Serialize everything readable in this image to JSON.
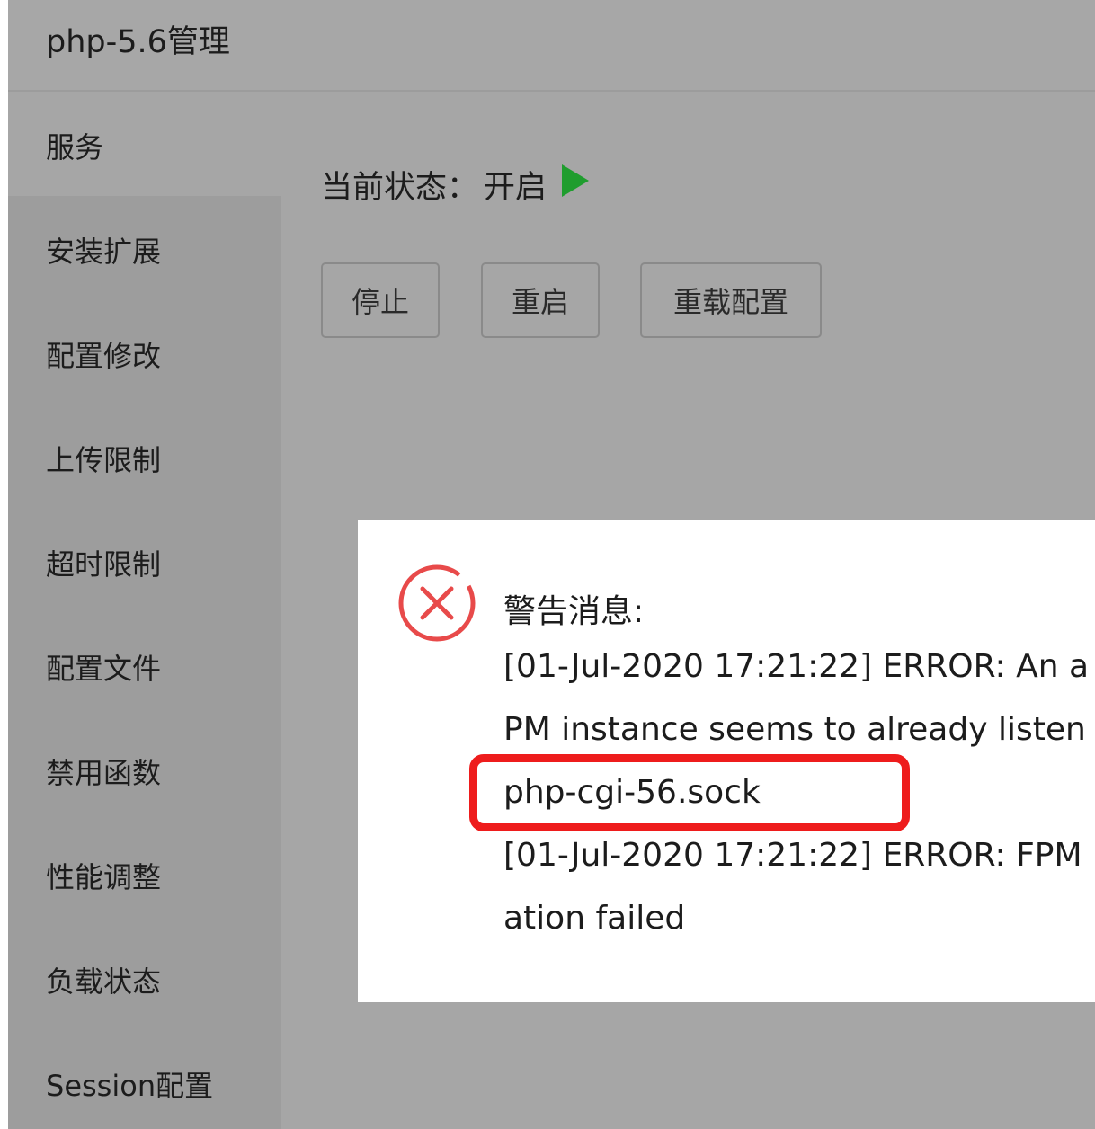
{
  "window": {
    "title": "php-5.6管理"
  },
  "sidebar": {
    "items": [
      {
        "label": "服务",
        "active": true
      },
      {
        "label": "安装扩展",
        "active": false
      },
      {
        "label": "配置修改",
        "active": false
      },
      {
        "label": "上传限制",
        "active": false
      },
      {
        "label": "超时限制",
        "active": false
      },
      {
        "label": "配置文件",
        "active": false
      },
      {
        "label": "禁用函数",
        "active": false
      },
      {
        "label": "性能调整",
        "active": false
      },
      {
        "label": "负载状态",
        "active": false
      },
      {
        "label": "Session配置",
        "active": false
      }
    ]
  },
  "service": {
    "status_label": "当前状态：",
    "status_value": "开启",
    "status_icon": "play-icon",
    "status_color": "#1f9d2e",
    "buttons": {
      "stop": "停止",
      "restart": "重启",
      "reload": "重载配置"
    }
  },
  "alert": {
    "icon": "error-icon",
    "icon_color": "#e84a4a",
    "title": "警告消息:",
    "lines": [
      "[01-Jul-2020 17:21:22] ERROR: An a",
      "PM instance seems to already listen",
      "php-cgi-56.sock",
      "[01-Jul-2020 17:21:22] ERROR: FPM",
      "ation failed"
    ],
    "highlight_color": "#ee1c1c"
  }
}
